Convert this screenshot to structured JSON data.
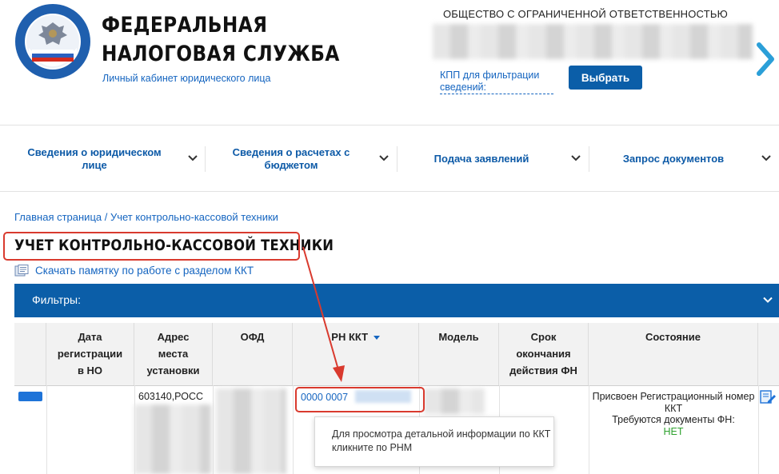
{
  "header": {
    "org_name_line1": "ФЕДЕРАЛЬНАЯ",
    "org_name_line2": "НАЛОГОВАЯ СЛУЖБА",
    "subtitle": "Личный кабинет юридического лица",
    "emblem_text": "ФЕДЕРАЛЬНАЯ НАЛОГОВАЯ СЛУЖБА",
    "company_label": "ОБЩЕСТВО С ОГРАНИЧЕННОЙ ОТВЕТСТВЕННОСТЬЮ",
    "kpp_filter_label": "КПП для фильтрации сведений:",
    "select_button": "Выбрать"
  },
  "nav": {
    "items": [
      {
        "label": "Сведения о юридическом лице"
      },
      {
        "label": "Сведения о расчетах с бюджетом"
      },
      {
        "label": "Подача заявлений"
      },
      {
        "label": "Запрос документов"
      }
    ]
  },
  "breadcrumb": "Главная страница / Учет контрольно-кассовой техники",
  "page_title": "УЧЕТ КОНТРОЛЬНО-КАССОВОЙ ТЕХНИКИ",
  "download_link": "Скачать памятку по работе с разделом ККТ",
  "filters_label": "Фильтры:",
  "table": {
    "columns": [
      "",
      "Дата регистрации в НО",
      "Адрес места установки",
      "ОФД",
      "РН ККТ",
      "Модель",
      "Срок окончания действия ФН",
      "Состояние"
    ],
    "row": {
      "address": "603140,РОСС",
      "rnm": "0000 0007",
      "status_line1": "Присвоен Регистрационный номер ККТ",
      "status_line2": "Требуются документы ФН:",
      "status_value": "НЕТ"
    }
  },
  "tooltip": "Для просмотра детальной информации по ККТ кликните по РНМ",
  "colors": {
    "brand_blue": "#0b5ea8",
    "link_blue": "#1565c0",
    "annotation_red": "#d93a2e",
    "ok_green": "#2ea12e"
  }
}
